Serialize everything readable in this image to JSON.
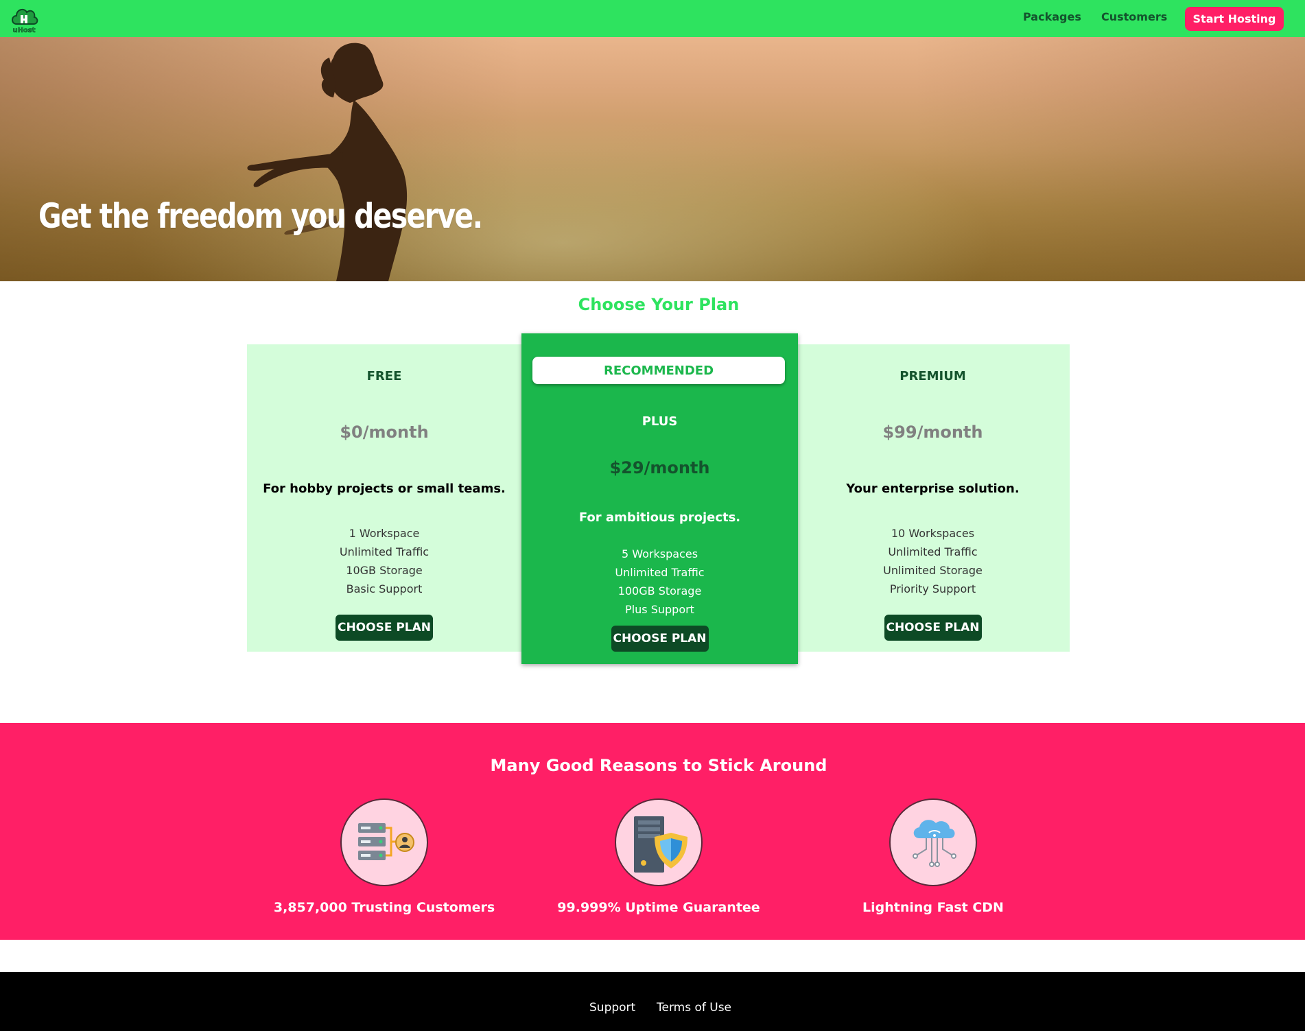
{
  "nav": {
    "logo_text": "uHost",
    "links": [
      "Packages",
      "Customers"
    ],
    "cta_label": "Start Hosting"
  },
  "hero": {
    "title": "Get the freedom you deserve."
  },
  "plans": {
    "title": "Choose Your Plan",
    "items": [
      {
        "name": "FREE",
        "price": "$0/month",
        "description": "For hobby projects or small teams.",
        "features": [
          "1 Workspace",
          "Unlimited Traffic",
          "10GB Storage",
          "Basic Support"
        ],
        "button": "CHOOSE PLAN"
      },
      {
        "badge": "RECOMMENDED",
        "name": "PLUS",
        "price": "$29/month",
        "description": "For ambitious projects.",
        "features": [
          "5 Workspaces",
          "Unlimited Traffic",
          "100GB Storage",
          "Plus Support"
        ],
        "button": "CHOOSE PLAN"
      },
      {
        "name": "PREMIUM",
        "price": "$99/month",
        "description": "Your enterprise solution.",
        "features": [
          "10 Workspaces",
          "Unlimited Traffic",
          "Unlimited Storage",
          "Priority Support"
        ],
        "button": "CHOOSE PLAN"
      }
    ]
  },
  "reasons": {
    "title": "Many Good Reasons to Stick Around",
    "items": [
      {
        "label": "3,857,000 Trusting Customers",
        "icon": "servers-customer-icon"
      },
      {
        "label": "99.999% Uptime Guarantee",
        "icon": "server-shield-icon"
      },
      {
        "label": "Lightning Fast CDN",
        "icon": "cloud-network-icon"
      }
    ]
  },
  "footer": {
    "links": [
      "Support",
      "Terms of Use"
    ]
  },
  "colors": {
    "nav_green": "#2ee35f",
    "accent_pink": "#ff1f66",
    "plan_bg": "#d4fdda",
    "plus_green": "#1bb74c",
    "dark_green": "#0d4a25"
  }
}
